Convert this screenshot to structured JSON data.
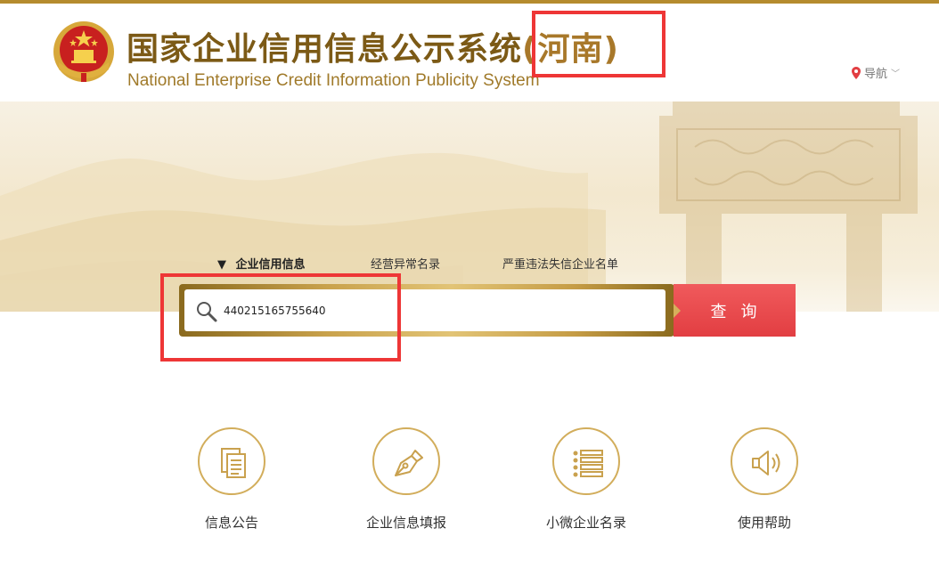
{
  "header": {
    "title": "国家企业信用信息公示系统",
    "region": "(河南)",
    "subtitle": "National Enterprise Credit Information Publicity System",
    "nav_label": "导航"
  },
  "search": {
    "tabs": [
      {
        "label": "企业信用信息",
        "active": true
      },
      {
        "label": "经营异常名录",
        "active": false
      },
      {
        "label": "严重违法失信企业名单",
        "active": false
      }
    ],
    "query_value": "440215165755640",
    "button_label": "查询"
  },
  "quick_links": [
    {
      "label": "信息公告",
      "icon": "document-icon"
    },
    {
      "label": "企业信息填报",
      "icon": "pen-icon"
    },
    {
      "label": "小微企业名录",
      "icon": "list-icon"
    },
    {
      "label": "使用帮助",
      "icon": "speaker-icon"
    }
  ],
  "colors": {
    "brand_gold": "#7c5a16",
    "accent_red": "#e23e42",
    "annotation_red": "#ee3636",
    "icon_gold": "#d2ad5b"
  }
}
